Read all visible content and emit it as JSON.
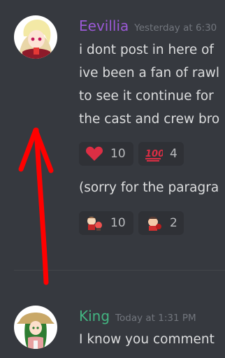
{
  "messages": [
    {
      "username": "Eevillia",
      "username_color": "#9b59d6",
      "timestamp": "Yesterday at 6:30",
      "lines": [
        "i dont post in here of",
        "ive been a fan of rawl",
        "to see it continue for",
        "the cast and crew bro"
      ],
      "reactions": [
        {
          "emoji": "heart-emoji",
          "count": "10"
        },
        {
          "emoji": "100-emoji",
          "count": "4"
        }
      ],
      "followup": "(sorry for the paragra",
      "followup_reactions": [
        {
          "emoji": "character-emote-1",
          "count": "10"
        },
        {
          "emoji": "character-emote-2",
          "count": "2"
        }
      ]
    },
    {
      "username": "King",
      "username_color": "#43b581",
      "timestamp": "Today at 1:31 PM",
      "lines": [
        "I know you comment"
      ]
    }
  ],
  "annotation": {
    "shape": "red-arrow-up",
    "color": "#ff0000"
  }
}
